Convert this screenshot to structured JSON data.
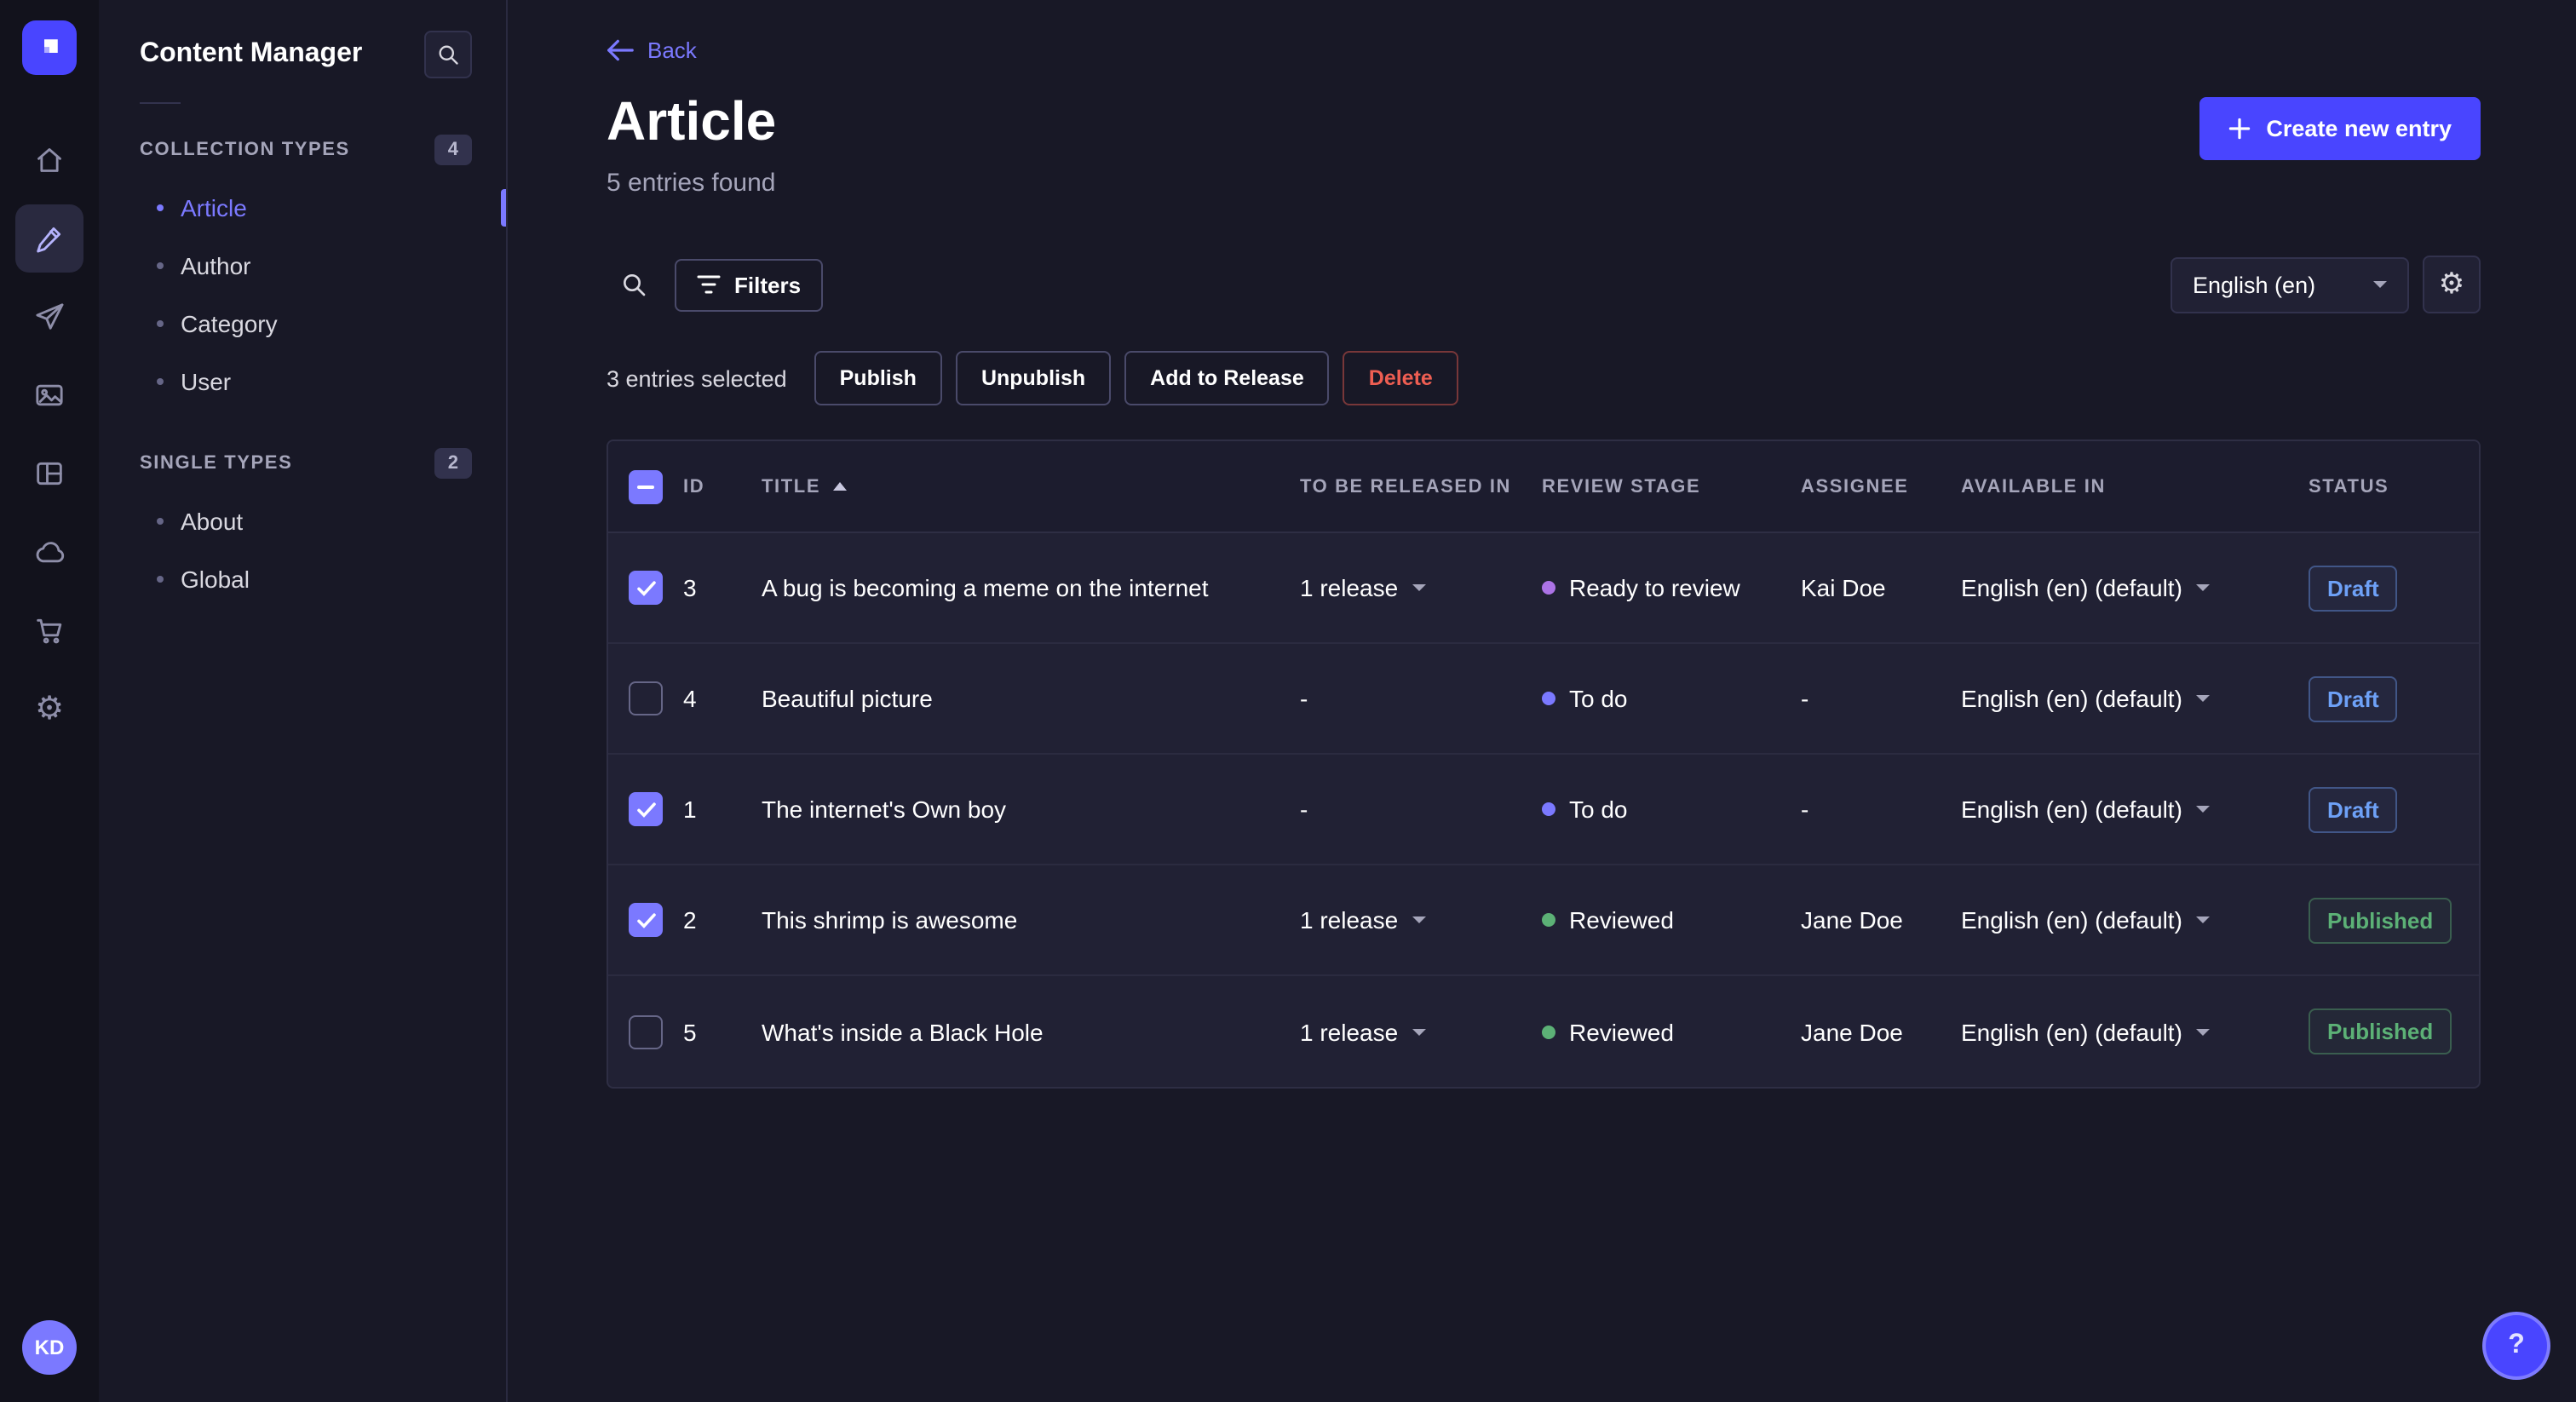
{
  "colors": {
    "accent": "#4945ff",
    "accent-light": "#7b79ff",
    "success": "#5cb176",
    "danger": "#ee5e52",
    "draft": "#6ea1f7"
  },
  "rail": {
    "items": [
      {
        "icon": "home-icon"
      },
      {
        "icon": "content-manager-icon",
        "active": true
      },
      {
        "icon": "releases-icon"
      },
      {
        "icon": "media-library-icon"
      },
      {
        "icon": "content-type-builder-icon"
      },
      {
        "icon": "deploy-icon"
      },
      {
        "icon": "marketplace-icon"
      },
      {
        "icon": "settings-icon"
      }
    ],
    "avatar_initials": "KD"
  },
  "sidebar": {
    "title": "Content Manager",
    "collection": {
      "label": "COLLECTION TYPES",
      "badge": "4",
      "items": [
        {
          "label": "Article",
          "active": true
        },
        {
          "label": "Author"
        },
        {
          "label": "Category"
        },
        {
          "label": "User"
        }
      ]
    },
    "single": {
      "label": "SINGLE TYPES",
      "badge": "2",
      "items": [
        {
          "label": "About"
        },
        {
          "label": "Global"
        }
      ]
    }
  },
  "header": {
    "back_label": "Back",
    "title": "Article",
    "subtitle": "5 entries found",
    "create_button": "Create new entry"
  },
  "toolbar": {
    "filters_label": "Filters",
    "locale": "English (en)"
  },
  "selection": {
    "text": "3 entries selected",
    "publish": "Publish",
    "unpublish": "Unpublish",
    "add_to_release": "Add to Release",
    "delete": "Delete"
  },
  "table": {
    "select_all_indeterminate": true,
    "columns": [
      {
        "label": "ID"
      },
      {
        "label": "TITLE",
        "sorted": true
      },
      {
        "label": "TO BE RELEASED IN"
      },
      {
        "label": "REVIEW STAGE"
      },
      {
        "label": "ASSIGNEE"
      },
      {
        "label": "AVAILABLE IN"
      },
      {
        "label": "STATUS"
      }
    ],
    "rows": [
      {
        "checked": true,
        "id": "3",
        "title": "A bug is becoming a meme on the internet",
        "release": "1 release",
        "has_release": true,
        "stage": "Ready to review",
        "stage_color": "#ac73e6",
        "assignee": "Kai Doe",
        "locale": "English (en) (default)",
        "status": "Draft",
        "status_variant": "draft"
      },
      {
        "checked": false,
        "id": "4",
        "title": "Beautiful picture",
        "release": "-",
        "has_release": false,
        "stage": "To do",
        "stage_color": "#7b79ff",
        "assignee": "-",
        "locale": "English (en) (default)",
        "status": "Draft",
        "status_variant": "draft"
      },
      {
        "checked": true,
        "id": "1",
        "title": "The internet's Own boy",
        "release": "-",
        "has_release": false,
        "stage": "To do",
        "stage_color": "#7b79ff",
        "assignee": "-",
        "locale": "English (en) (default)",
        "status": "Draft",
        "status_variant": "draft"
      },
      {
        "checked": true,
        "id": "2",
        "title": "This shrimp is awesome",
        "release": "1 release",
        "has_release": true,
        "stage": "Reviewed",
        "stage_color": "#5cb176",
        "assignee": "Jane Doe",
        "locale": "English (en) (default)",
        "status": "Published",
        "status_variant": "published"
      },
      {
        "checked": false,
        "id": "5",
        "title": "What's inside a Black Hole",
        "release": "1 release",
        "has_release": true,
        "stage": "Reviewed",
        "stage_color": "#5cb176",
        "assignee": "Jane Doe",
        "locale": "English (en) (default)",
        "status": "Published",
        "status_variant": "published"
      }
    ]
  },
  "help": {
    "label": "?"
  }
}
